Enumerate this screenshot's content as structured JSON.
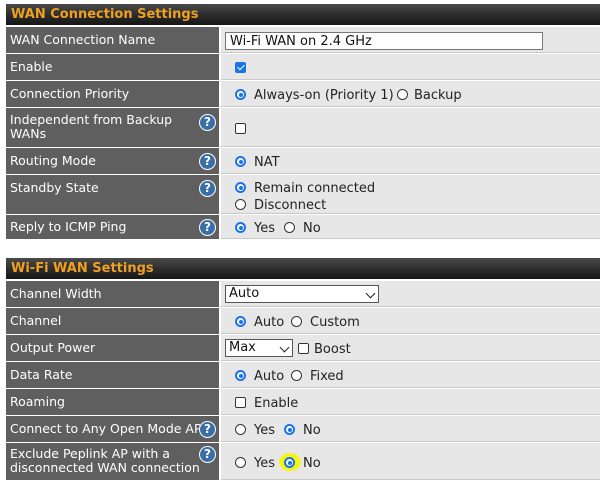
{
  "wan": {
    "title": "WAN Connection Settings",
    "connection_name_label": "WAN Connection Name",
    "connection_name_value": "Wi-Fi WAN on 2.4 GHz",
    "enable_label": "Enable",
    "priority_label": "Connection Priority",
    "priority_always_on": "Always-on (Priority 1)",
    "priority_backup": "Backup",
    "independent_label_1": "Independent from Backup",
    "independent_label_2": "WANs",
    "routing_mode_label": "Routing Mode",
    "routing_nat": "NAT",
    "standby_label": "Standby State",
    "standby_remain": "Remain connected",
    "standby_disconnect": "Disconnect",
    "icmp_label": "Reply to ICMP Ping",
    "icmp_yes": "Yes",
    "icmp_no": "No"
  },
  "wifi": {
    "title": "Wi-Fi WAN Settings",
    "channel_width_label": "Channel Width",
    "channel_width_value": "Auto",
    "channel_label": "Channel",
    "channel_auto": "Auto",
    "channel_custom": "Custom",
    "output_power_label": "Output Power",
    "output_power_value": "Max",
    "boost_label": "Boost",
    "data_rate_label": "Data Rate",
    "data_rate_auto": "Auto",
    "data_rate_fixed": "Fixed",
    "roaming_label": "Roaming",
    "roaming_enable": "Enable",
    "open_ap_label": "Connect to Any Open Mode AP",
    "open_ap_yes": "Yes",
    "open_ap_no": "No",
    "exclude_label_1": "Exclude Peplink AP with a",
    "exclude_label_2": "disconnected WAN connection",
    "exclude_yes": "Yes",
    "exclude_no": "No"
  },
  "help_glyph": "?",
  "colors": {
    "header_text": "#f0a020",
    "label_bg": "#5f5f5f",
    "value_bg": "#e7e7e7",
    "accent": "#1a73e8",
    "help": "#3a6ea8",
    "highlight": "#f4f416"
  }
}
